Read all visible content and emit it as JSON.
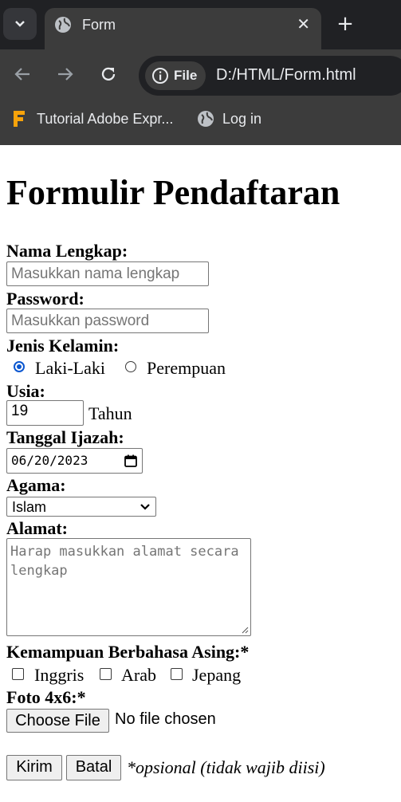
{
  "browser": {
    "tab_title": "Form",
    "url_chip": "File",
    "url": "D:/HTML/Form.html",
    "bookmarks": [
      {
        "label": "Tutorial Adobe Expr...",
        "icon": "adobe-express-logo-icon"
      },
      {
        "label": "Log in",
        "icon": "globe-icon"
      }
    ]
  },
  "form": {
    "title": "Formulir Pendaftaran",
    "nama_label": "Nama Lengkap:",
    "nama_placeholder": "Masukkan nama lengkap",
    "password_label": "Password:",
    "password_placeholder": "Masukkan password",
    "gender_label": "Jenis Kelamin:",
    "gender_options": [
      {
        "label": "Laki-Laki",
        "checked": true
      },
      {
        "label": "Perempuan",
        "checked": false
      }
    ],
    "usia_label": "Usia:",
    "usia_value": "19",
    "usia_unit": "Tahun",
    "tanggal_label": "Tanggal Ijazah:",
    "tanggal_value": "06/20/2023",
    "agama_label": "Agama:",
    "agama_selected": "Islam",
    "alamat_label": "Alamat:",
    "alamat_placeholder": "Harap masukkan alamat secara lengkap",
    "bahasa_label": "Kemampuan Berbahasa Asing:*",
    "bahasa_options": [
      {
        "label": "Inggris",
        "checked": false
      },
      {
        "label": "Arab",
        "checked": false
      },
      {
        "label": "Jepang",
        "checked": false
      }
    ],
    "foto_label": "Foto 4x6:*",
    "file_button": "Choose File",
    "file_status": "No file chosen",
    "submit_label": "Kirim",
    "reset_label": "Batal",
    "note": "*opsional (tidak wajib diisi)"
  },
  "colors": {
    "accent": "#0b57d0",
    "chrome_dark": "#202124",
    "chrome_toolbar": "#3c3c3c"
  }
}
